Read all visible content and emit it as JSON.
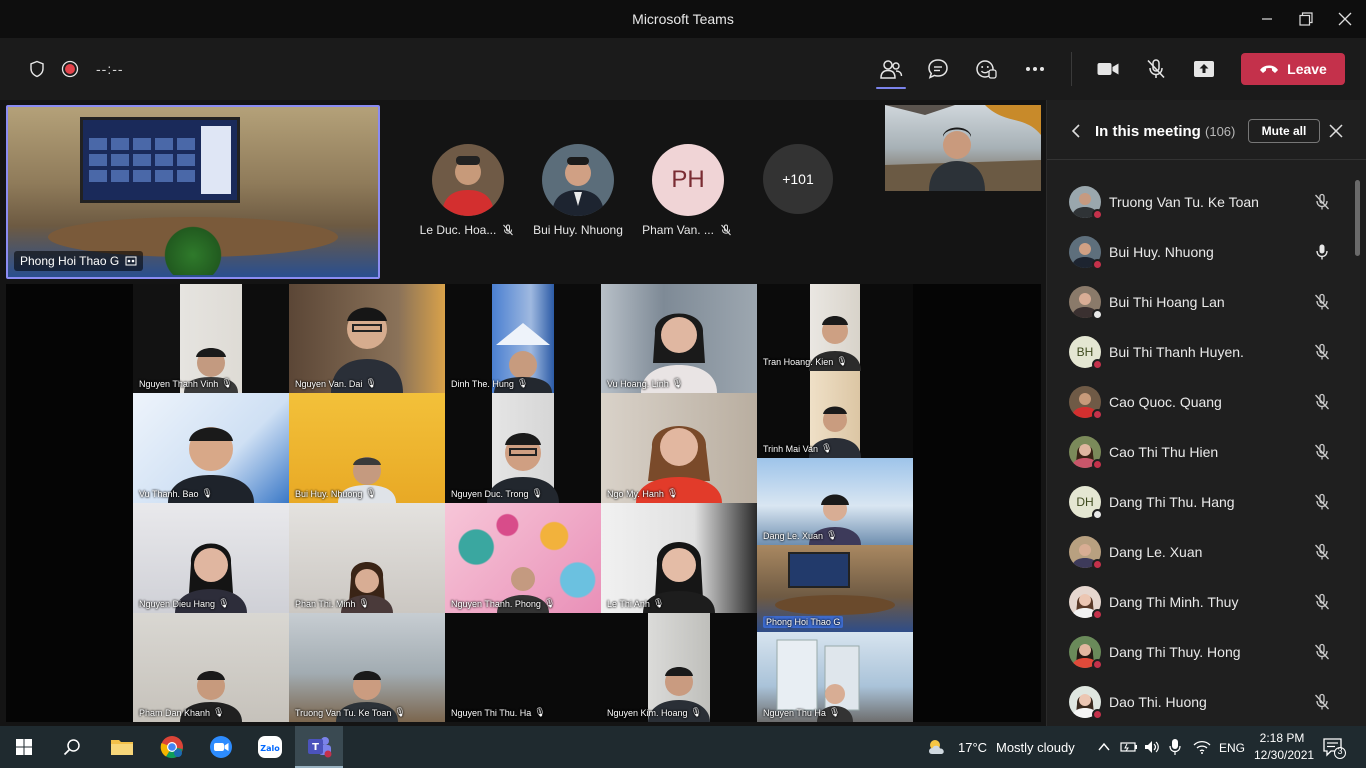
{
  "window": {
    "title": "Microsoft Teams"
  },
  "toolbar": {
    "timer": "--:--",
    "leave_label": "Leave"
  },
  "spotlight": {
    "label": "Phong Hoi Thao G"
  },
  "top_avatars": [
    {
      "name": "Le Duc. Hoa..."
    },
    {
      "name": "Bui Huy. Nhuong"
    },
    {
      "name": "Pham Van. ...",
      "initials": "PH"
    }
  ],
  "overflow_count": "+101",
  "gallery": [
    {
      "name": "Nguyen Thanh Vinh"
    },
    {
      "name": "Nguyen Van. Dai"
    },
    {
      "name": "Dinh The. Hung"
    },
    {
      "name": "Vu Hoang. Linh"
    },
    {
      "name": "Tran Hoang. Kien"
    },
    {
      "name": "Trinh Mai Van"
    },
    {
      "name": "Vu Thanh. Bao"
    },
    {
      "name": "Bui Huy. Nhuong"
    },
    {
      "name": "Nguyen Duc. Trong"
    },
    {
      "name": "Ngo My. Hanh"
    },
    {
      "name": "Dang Le. Xuan"
    },
    {
      "name": "Nguyen Dieu Hang"
    },
    {
      "name": "Phan Thi. Minh"
    },
    {
      "name": "Nguyen Thanh. Phong"
    },
    {
      "name": "Le Thi Anh"
    },
    {
      "name": "Phong Hoi Thao G"
    },
    {
      "name": "Pham Dan Khanh"
    },
    {
      "name": "Truong Van Tu. Ke Toan"
    },
    {
      "name": "Nguyen Thi Thu. Ha"
    },
    {
      "name": "Nguyen Kim. Hoang"
    },
    {
      "name": "Nguyen Thu Ha"
    }
  ],
  "panel": {
    "title": "In this meeting",
    "count": "(106)",
    "mute_all_label": "Mute all",
    "participants": [
      {
        "name": "Truong Van Tu. Ke Toan"
      },
      {
        "name": "Bui Huy. Nhuong"
      },
      {
        "name": "Bui Thi Hoang Lan"
      },
      {
        "name": "Bui Thi Thanh Huyen.",
        "initials": "BH"
      },
      {
        "name": "Cao Quoc. Quang"
      },
      {
        "name": "Cao Thi Thu Hien"
      },
      {
        "name": "Dang Thi Thu. Hang",
        "initials": "DH"
      },
      {
        "name": "Dang Le. Xuan"
      },
      {
        "name": "Dang Thi Minh. Thuy"
      },
      {
        "name": "Dang Thi Thuy. Hong"
      },
      {
        "name": "Dao Thi. Huong"
      }
    ]
  },
  "taskbar": {
    "weather_temp": "17°C",
    "weather_desc": "Mostly cloudy",
    "language": "ENG",
    "time": "2:18 PM",
    "date": "12/30/2021",
    "notifications": "3"
  },
  "colors": {
    "accent": "#7b83eb",
    "leave": "#c4314b",
    "panel_bg": "#1f1f1f",
    "presence_busy": "#c4314b"
  }
}
